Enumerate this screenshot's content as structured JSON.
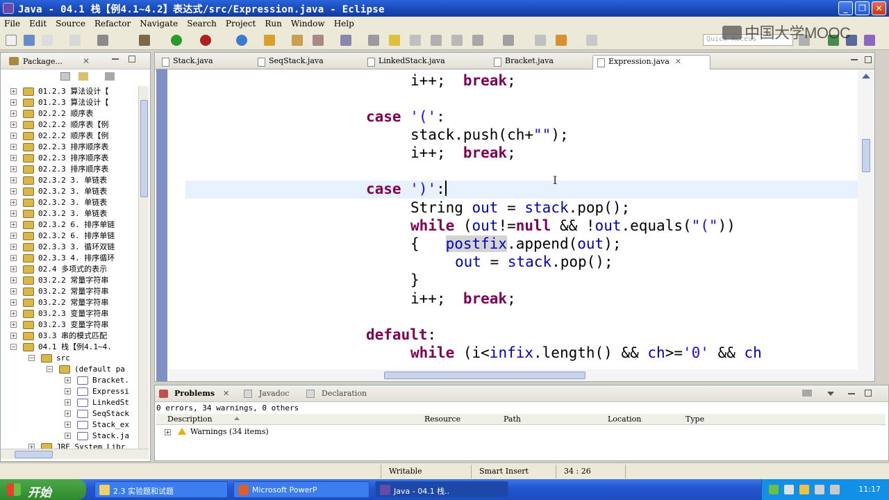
{
  "window": {
    "title": "Java - 04.1  栈【例4.1~4.2】表达式/src/Expression.java - Eclipse",
    "minimize": "_",
    "maximize": "❐",
    "close": "✕"
  },
  "menu": [
    "File",
    "Edit",
    "Source",
    "Refactor",
    "Navigate",
    "Search",
    "Project",
    "Run",
    "Window",
    "Help"
  ],
  "watermark": "中国大学MOOC",
  "quick_access": {
    "placeholder": "Quick Access"
  },
  "package_explorer": {
    "title": "Package...",
    "close": "✕",
    "items": [
      {
        "label": "01.2.3  算法设计【"
      },
      {
        "label": "01.2.3  算法设计【"
      },
      {
        "label": "02.2.2  顺序表"
      },
      {
        "label": "02.2.2  顺序表【例"
      },
      {
        "label": "02.2.2  顺序表【例"
      },
      {
        "label": "02.2.3  排序顺序表"
      },
      {
        "label": "02.2.3  排序顺序表"
      },
      {
        "label": "02.2.3  排序顺序表"
      },
      {
        "label": "02.3.2  3. 单链表"
      },
      {
        "label": "02.3.2  3. 单链表"
      },
      {
        "label": "02.3.2  3. 单链表"
      },
      {
        "label": "02.3.2  3. 单链表"
      },
      {
        "label": "02.3.2  6. 排序单链"
      },
      {
        "label": "02.3.2  6. 排序单链"
      },
      {
        "label": "02.3.3  3. 循环双链"
      },
      {
        "label": "02.3.3  4. 排序循环"
      },
      {
        "label": "02.4  多项式的表示"
      },
      {
        "label": "03.2.2  常量字符串"
      },
      {
        "label": "03.2.2  常量字符串"
      },
      {
        "label": "03.2.2  常量字符串"
      },
      {
        "label": "03.2.3  变量字符串"
      },
      {
        "label": "03.2.3  变量字符串"
      },
      {
        "label": "03.3  串的模式匹配"
      },
      {
        "label": "04.1  栈【例4.1~4."
      },
      {
        "label": "src"
      },
      {
        "label": "(default pa"
      },
      {
        "label": "Bracket."
      },
      {
        "label": "Expressi"
      },
      {
        "label": "LinkedSt"
      },
      {
        "label": "SeqStack"
      },
      {
        "label": "Stack_ex"
      },
      {
        "label": "Stack.ja"
      },
      {
        "label": "JRE System Libr"
      }
    ]
  },
  "editor": {
    "tabs": [
      {
        "label": "Stack.java"
      },
      {
        "label": "SeqStack.java"
      },
      {
        "label": "LinkedStack.java"
      },
      {
        "label": "Bracket.java"
      },
      {
        "label": "Expression.java",
        "active": true
      }
    ],
    "tab_close": "✕",
    "code": {
      "l1_a": "i++;  ",
      "l1_b": "break",
      "l1_c": ";",
      "l2_a": "case",
      "l2_b": " ",
      "l2_c": "'('",
      "l2_d": ":",
      "l3_a": "stack.push(ch+",
      "l3_b": "\"\"",
      "l3_c": ");",
      "l4_a": "i++;  ",
      "l4_b": "break",
      "l4_c": ";",
      "l5_a": "case",
      "l5_b": " ",
      "l5_c": "')'",
      "l5_d": ":",
      "l6_a": "String ",
      "l6_b": "out",
      "l6_c": " = ",
      "l6_d": "stack",
      "l6_e": ".pop();",
      "l7_a": "while",
      "l7_b": " (",
      "l7_c": "out",
      "l7_d": "!=",
      "l7_e": "null",
      "l7_f": " && !",
      "l7_g": "out",
      "l7_h": ".equals(",
      "l7_i": "\"(\"",
      "l7_j": "))",
      "l8_a": "{   ",
      "l8_b": "postfix",
      "l8_c": ".append(",
      "l8_d": "out",
      "l8_e": ");",
      "l9_a": "out",
      "l9_b": " = ",
      "l9_c": "stack",
      "l9_d": ".pop();",
      "l10_a": "}",
      "l11_a": "i++;  ",
      "l11_b": "break",
      "l11_c": ";",
      "l12_a": "default",
      "l12_b": ":",
      "l13_a": "while",
      "l13_b": " (i<",
      "l13_c": "infix",
      "l13_d": ".length() && ",
      "l13_e": "ch",
      "l13_f": ">=",
      "l13_g": "'0'",
      "l13_h": " && ",
      "l13_i": "ch"
    }
  },
  "problems": {
    "tabs": [
      {
        "label": "Problems",
        "active": true
      },
      {
        "label": "Javadoc"
      },
      {
        "label": "Declaration"
      }
    ],
    "summary": "0 errors, 34 warnings, 0 others",
    "columns": [
      "Description",
      "Resource",
      "Path",
      "Location",
      "Type"
    ],
    "rows": [
      {
        "label": "Warnings (34 items)"
      }
    ]
  },
  "status": {
    "writable": "Writable",
    "insert_mode": "Smart Insert",
    "position": "34 : 26"
  },
  "taskbar": {
    "start": "开始",
    "tasks": [
      {
        "label": "2.3 实验题和试题"
      },
      {
        "label": "Microsoft PowerP"
      },
      {
        "label": "Java - 04.1  栈.."
      }
    ],
    "clock": "11:17"
  },
  "colors": {
    "keyword": "#7f0055",
    "string": "#2a00ff",
    "field": "#0000c0",
    "current_line": "#e8f2fe"
  }
}
